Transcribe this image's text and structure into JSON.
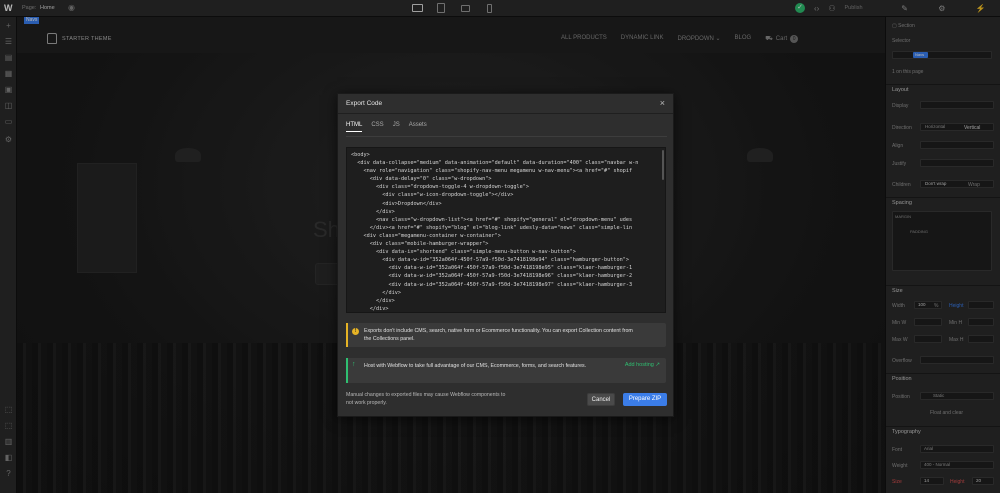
{
  "topbar": {
    "page_label": "Page:",
    "page_value": "Home",
    "publish_label": "Publish"
  },
  "canvas": {
    "selected_tag": "Navs",
    "brand": "STARTER THEME",
    "nav_links": [
      "ALL PRODUCTS",
      "DYNAMIC LINK",
      "DROPDOWN"
    ],
    "dropdown_caret": "⌄",
    "blog": "BLOG",
    "cart_label": "Cart",
    "cart_count": "0",
    "hero_letters": "Sh"
  },
  "modal": {
    "title": "Export Code",
    "close_glyph": "×",
    "tabs": [
      "HTML",
      "CSS",
      "JS",
      "Assets"
    ],
    "active_tab": "HTML",
    "code_lines": [
      "<body>",
      "  <div data-collapse=\"medium\" data-animation=\"default\" data-duration=\"400\" class=\"navbar w-n",
      "    <nav role=\"navigation\" class=\"shopify-nav-menu megamenu w-nav-menu\"><a href=\"#\" shopif",
      "      <div data-delay=\"0\" class=\"w-dropdown\">",
      "        <div class=\"dropdown-toggle-4 w-dropdown-toggle\">",
      "          <div class=\"w-icon-dropdown-toggle\"></div>",
      "          <div>Dropdown</div>",
      "        </div>",
      "        <nav class=\"w-dropdown-list\"><a href=\"#\" shopify=\"general\" el=\"dropdown-menu\" udes",
      "      </div><a href=\"#\" shopify=\"blog\" el=\"blog-link\" udesly-data=\"news\" class=\"simple-lin",
      "    <div class=\"megamenu-container w-container\">",
      "      <div class=\"mobile-hamburger-wrapper\">",
      "        <div data-ix=\"shortend\" class=\"simple-menu-button w-nav-button\">",
      "          <div data-w-id=\"352a064f-450f-57a9-f50d-3e7418198e94\" class=\"hamburger-button\">",
      "            <div data-w-id=\"352a064f-450f-57a9-f50d-3e7418198e95\" class=\"klaer-hamburger-1",
      "            <div data-w-id=\"352a064f-450f-57a9-f50d-3e7418198e96\" class=\"klaer-hamburger-2",
      "            <div data-w-id=\"352a064f-450f-57a9-f50d-3e7418198e97\" class=\"klaer-hamburger-3",
      "          </div>",
      "        </div>",
      "      </div>"
    ],
    "warning_text": "Exports don't include CMS, search, native form or Ecommerce functionality. You can export Collection content from the Collections panel.",
    "hosting_text": "Host with Webflow to take full advantage of our CMS, Ecommerce, forms, and search features.",
    "add_hosting": "Add hosting ↗",
    "footer_note": "Manual changes to exported files may cause Webflow components to not work properly.",
    "cancel_label": "Cancel",
    "zip_label": "Prepare ZIP"
  },
  "right_panel": {
    "selector_label": "Selector",
    "selector_value": "Navs",
    "on_page": "1 on this page",
    "sections": [
      "Layout",
      "Spacing",
      "Size",
      "Position",
      "Typography"
    ],
    "display_label": "Display",
    "direction_label": "Direction",
    "direction_options": [
      "Horizontal",
      "Vertical"
    ],
    "align_label": "Align",
    "justify_label": "Justify",
    "children_label": "Children",
    "children_options": [
      "Don't wrap",
      "Wrap"
    ],
    "margin_label": "MARGIN",
    "padding_label": "PADDING",
    "width_label": "Width",
    "width_value": "100",
    "width_unit": "%",
    "height_label": "Height",
    "min_w": "Min W",
    "min_h": "Min H",
    "max_w": "Max W",
    "max_h": "Max H",
    "overflow_label": "Overflow",
    "position_label": "Position",
    "position_value": "Static",
    "float_clear": "Float and clear",
    "font_label": "Font",
    "font_value": "Arial",
    "weight_label": "Weight",
    "weight_value": "400 - Normal",
    "size_label": "Size",
    "size_value": "14",
    "height_value": "20"
  },
  "colors": {
    "accent": "#3b82f6",
    "success": "#2fbf71",
    "warning": "#e6b325"
  }
}
